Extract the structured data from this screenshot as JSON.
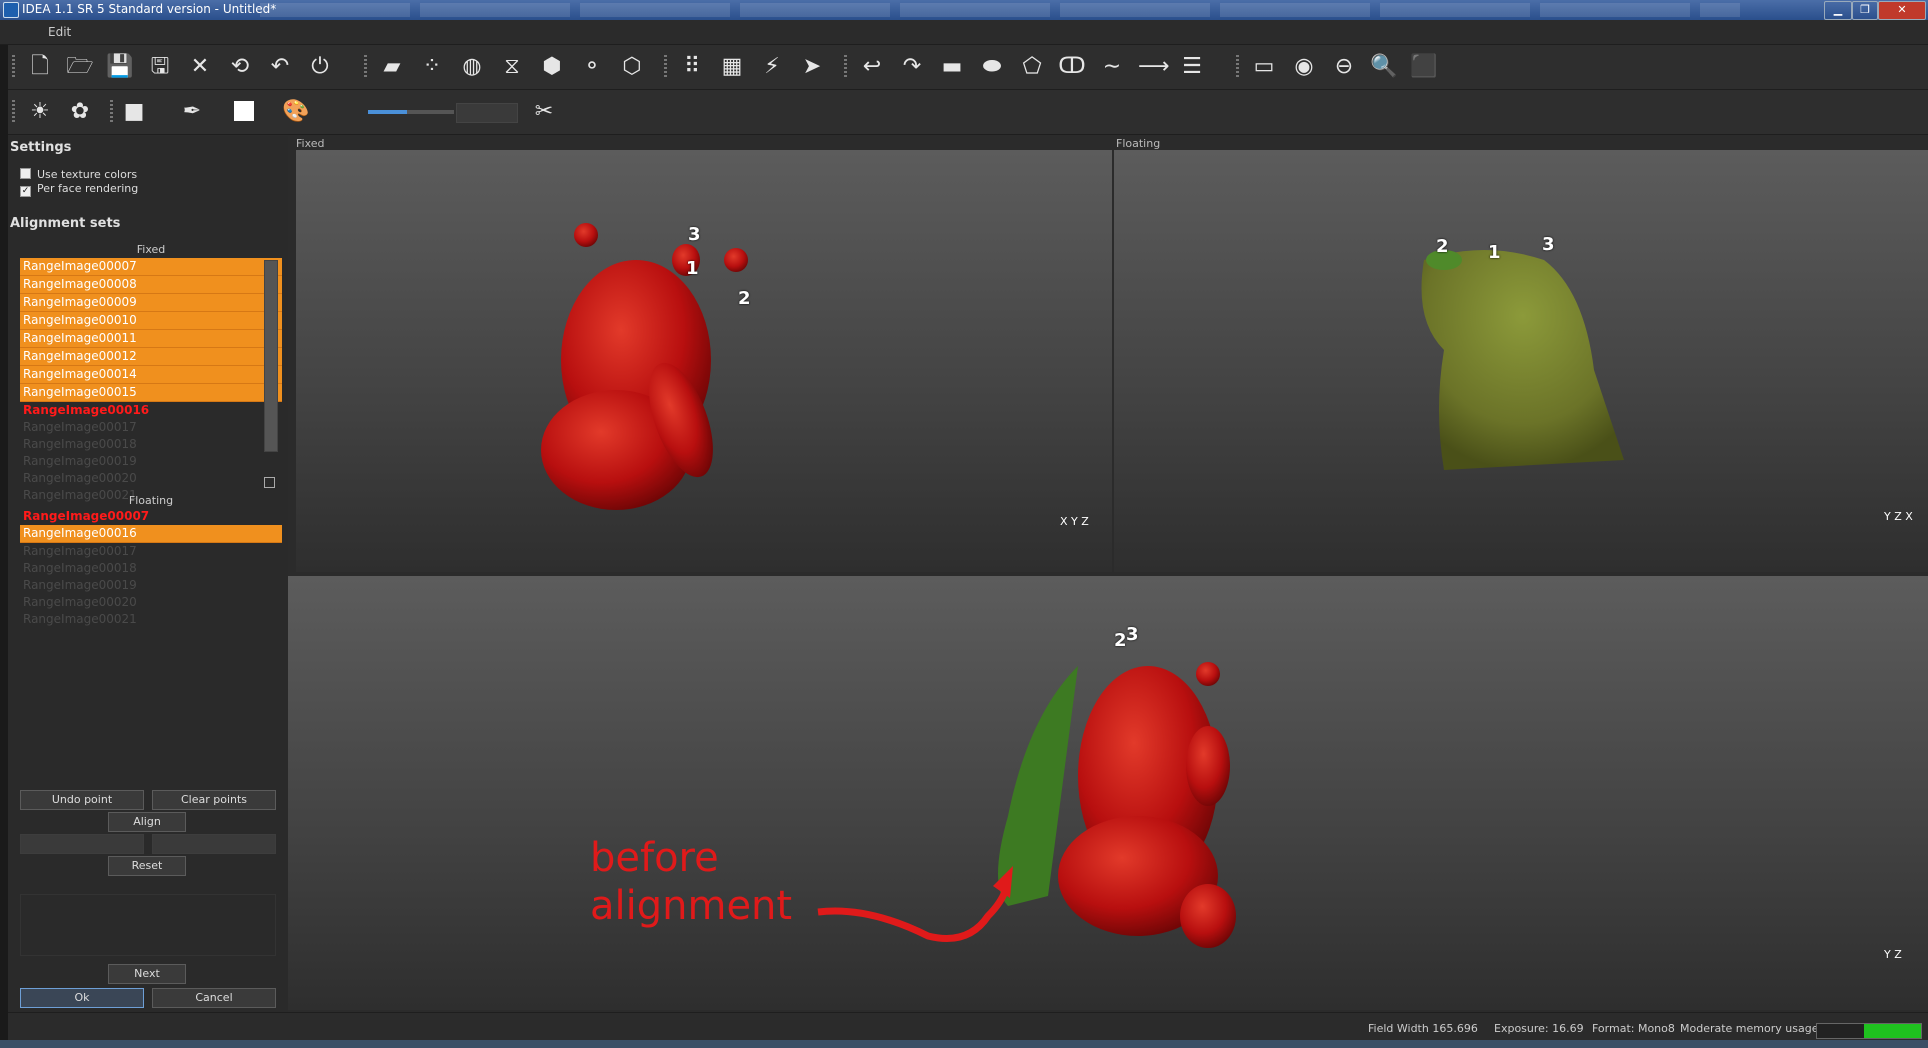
{
  "window": {
    "title": "IDEA 1.1 SR 5 Standard version - Untitled*"
  },
  "menu": {
    "edit": "Edit"
  },
  "toolbar1": {
    "icons": [
      "new-file-icon",
      "open-folder-icon",
      "save-icon",
      "save-as-icon",
      "close-icon",
      "rotate-icon",
      "undo-icon",
      "power-icon",
      "mesh-icon",
      "points-icon",
      "globe-icon",
      "filter-icon",
      "merge-icon",
      "split-icon",
      "hexagon-icon",
      "grid-sparse-icon",
      "grid-dense-icon",
      "wand-icon",
      "arrow-right-icon",
      "hook-icon",
      "curve-icon",
      "rectangle-icon",
      "ellipse-icon",
      "polygon-icon",
      "lasso-icon",
      "line-icon",
      "line-arrow-icon",
      "list-icon",
      "panel-icon",
      "sphere-icon",
      "plane-icon",
      "zoom-icon",
      "cube-icon"
    ]
  },
  "toolbar2": {
    "icons": [
      "light-icon",
      "texture-icon",
      "square-icon",
      "pen-icon",
      "color-swatch-icon",
      "palette-icon",
      "tools-icon"
    ],
    "slider": 0.45
  },
  "panel": {
    "settings_title": "Settings",
    "use_texture": "Use texture colors",
    "per_face": "Per face rendering",
    "alignment_title": "Alignment sets",
    "fixed_label": "Fixed",
    "floating_label": "Floating",
    "fixed_items": [
      {
        "label": "RangeImage00007",
        "state": "sel"
      },
      {
        "label": "RangeImage00008",
        "state": "sel"
      },
      {
        "label": "RangeImage00009",
        "state": "sel"
      },
      {
        "label": "RangeImage00010",
        "state": "sel"
      },
      {
        "label": "RangeImage00011",
        "state": "sel"
      },
      {
        "label": "RangeImage00012",
        "state": "sel"
      },
      {
        "label": "RangeImage00014",
        "state": "sel"
      },
      {
        "label": "RangeImage00015",
        "state": "sel"
      },
      {
        "label": "RangeImage00016",
        "state": "red"
      },
      {
        "label": "RangeImage00017",
        "state": "dim"
      },
      {
        "label": "RangeImage00018",
        "state": "dim"
      },
      {
        "label": "RangeImage00019",
        "state": "dim"
      },
      {
        "label": "RangeImage00020",
        "state": "dim"
      },
      {
        "label": "RangeImage00021",
        "state": "dim"
      }
    ],
    "floating_items": [
      {
        "label": "RangeImage00007",
        "state": "red"
      },
      {
        "label": "RangeImage00016",
        "state": "sel"
      },
      {
        "label": "RangeImage00017",
        "state": "dim"
      },
      {
        "label": "RangeImage00018",
        "state": "dim"
      },
      {
        "label": "RangeImage00019",
        "state": "dim"
      },
      {
        "label": "RangeImage00020",
        "state": "dim"
      },
      {
        "label": "RangeImage00021",
        "state": "dim"
      }
    ],
    "undo_point": "Undo point",
    "clear_points": "Clear points",
    "align": "Align",
    "reset": "Reset",
    "next": "Next",
    "ok": "Ok",
    "cancel": "Cancel"
  },
  "viewports": {
    "fixed_label": "Fixed",
    "floating_label": "Floating",
    "points_fixed": [
      "1",
      "2",
      "3"
    ],
    "points_floating": [
      "1",
      "2",
      "3"
    ],
    "points_merged": [
      "2",
      "3"
    ]
  },
  "annotation": {
    "line1": "before",
    "line2": "alignment",
    "color": "#e01a1a"
  },
  "status": {
    "field_width": "Field Width 165.696",
    "exposure": "Exposure: 16.69",
    "format": "Format: Mono8",
    "memory": "Moderate memory usage",
    "memory_level": 0.55
  }
}
